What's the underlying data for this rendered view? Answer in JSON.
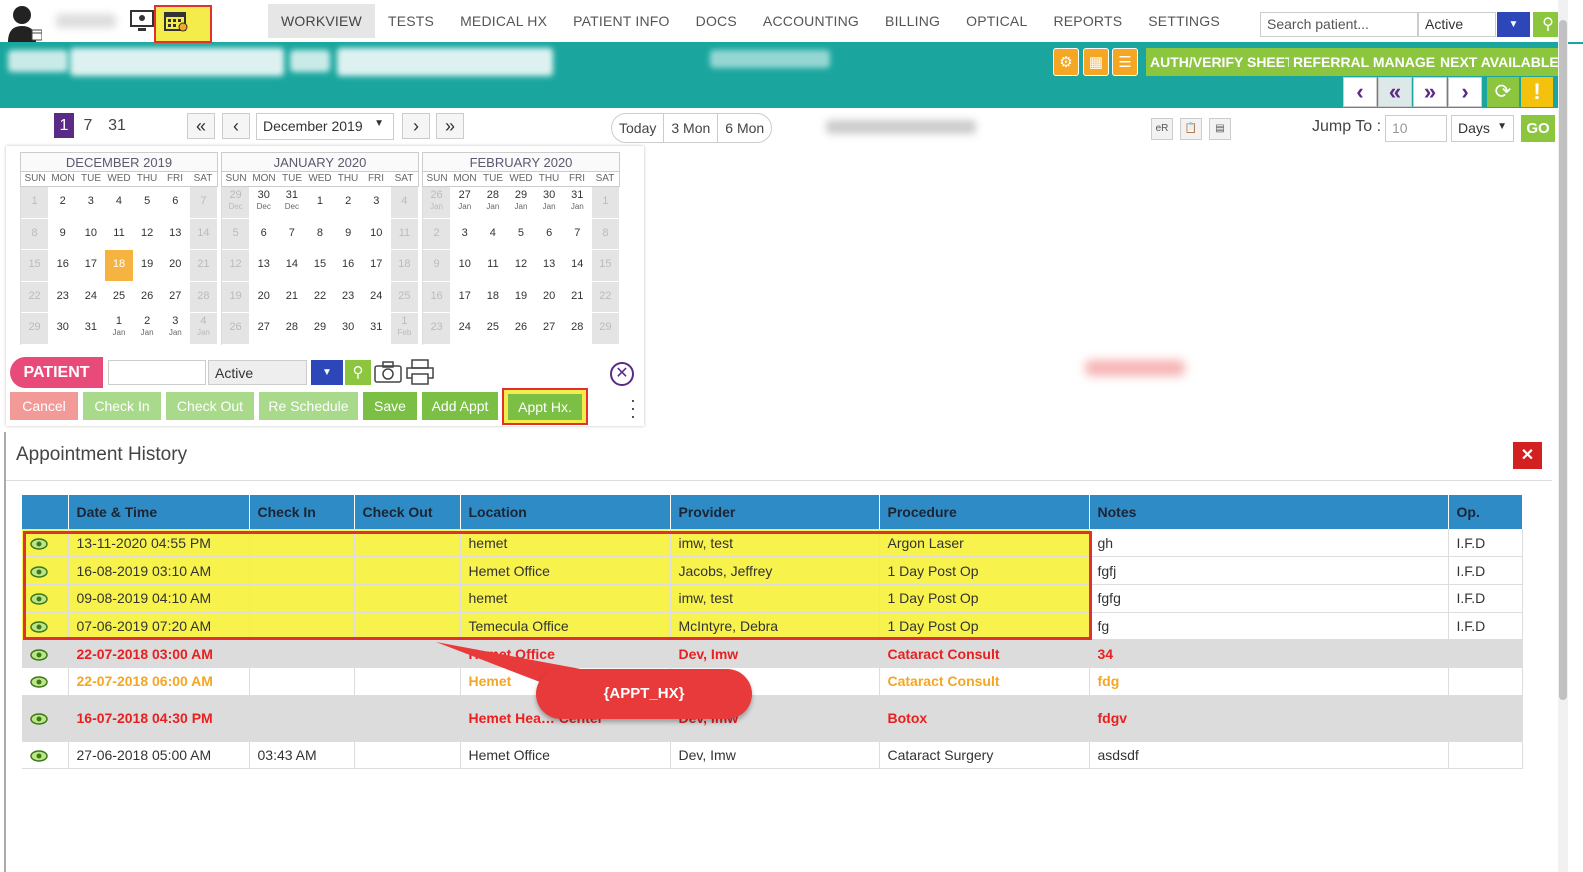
{
  "nav": {
    "items": [
      "WORKVIEW",
      "TESTS",
      "MEDICAL HX",
      "PATIENT INFO",
      "DOCS",
      "ACCOUNTING",
      "BILLING",
      "OPTICAL",
      "REPORTS",
      "SETTINGS"
    ],
    "active": "WORKVIEW"
  },
  "search": {
    "placeholder": "Search patient...",
    "status": "Active"
  },
  "teal_toolbar": {
    "buttons": [
      "AUTH/VERIFY SHEET",
      "REFERRAL MANAGER",
      "NEXT AVAILABLE"
    ]
  },
  "view": {
    "counts": [
      "1",
      "7",
      "31"
    ],
    "month": "December 2019",
    "ranges": [
      "Today",
      "3 Mon",
      "6 Mon"
    ],
    "jump_label": "Jump To :",
    "jump_placeholder": "10",
    "jump_unit": "Days",
    "go_label": "GO",
    "small_icon_er": "eR"
  },
  "dow": [
    "SUN",
    "MON",
    "TUE",
    "WED",
    "THU",
    "FRI",
    "SAT"
  ],
  "calendars": [
    {
      "title": "DECEMBER 2019"
    },
    {
      "title": "JANUARY 2020"
    },
    {
      "title": "FEBRUARY 2020"
    }
  ],
  "patient_bar": {
    "label": "PATIENT",
    "status": "Active"
  },
  "actions": {
    "cancel": "Cancel",
    "check_in": "Check In",
    "check_out": "Check Out",
    "reschedule": "Re Schedule",
    "save": "Save",
    "add_appt": "Add Appt",
    "appt_hx": "Appt Hx."
  },
  "history": {
    "title": "Appointment History",
    "columns": [
      "Date & Time",
      "Check In",
      "Check Out",
      "Location",
      "Provider",
      "Procedure",
      "Notes",
      "Op."
    ],
    "rows": [
      {
        "date": "13-11-2020 04:55 PM",
        "check_in": "",
        "check_out": "",
        "location": "hemet",
        "provider": "imw, test",
        "procedure": "Argon Laser",
        "notes": "gh",
        "op": "I.F.D"
      },
      {
        "date": "16-08-2019 03:10 AM",
        "check_in": "",
        "check_out": "",
        "location": "Hemet Office",
        "provider": "Jacobs, Jeffrey",
        "procedure": "1 Day Post Op",
        "notes": "fgfj",
        "op": "I.F.D"
      },
      {
        "date": "09-08-2019 04:10 AM",
        "check_in": "",
        "check_out": "",
        "location": "hemet",
        "provider": "imw, test",
        "procedure": "1 Day Post Op",
        "notes": "fgfg",
        "op": "I.F.D"
      },
      {
        "date": "07-06-2019 07:20 AM",
        "check_in": "",
        "check_out": "",
        "location": "Temecula Office",
        "provider": "McIntyre, Debra",
        "procedure": "1 Day Post Op",
        "notes": "fg",
        "op": "I.F.D"
      },
      {
        "date": "22-07-2018 03:00 AM",
        "check_in": "",
        "check_out": "",
        "location": "Hemet Office",
        "provider": "Dev, Imw",
        "procedure": "Cataract Consult",
        "notes": "34",
        "op": ""
      },
      {
        "date": "22-07-2018 06:00 AM",
        "check_in": "",
        "check_out": "",
        "location": "Hemet",
        "provider": "",
        "procedure": "Cataract Consult",
        "notes": "fdg",
        "op": ""
      },
      {
        "date": "16-07-2018 04:30 PM",
        "check_in": "",
        "check_out": "",
        "location": "Hemet Hea… Center",
        "provider": "Dev, Imw",
        "procedure": "Botox",
        "notes": "fdgv",
        "op": ""
      },
      {
        "date": "27-06-2018 05:00 AM",
        "check_in": "03:43 AM",
        "check_out": "",
        "location": "Hemet Office",
        "provider": "Dev, Imw",
        "procedure": "Cataract Surgery",
        "notes": "asdsdf",
        "op": ""
      }
    ]
  },
  "callout": "{APPT_HX}",
  "colors": {
    "teal": "#1aa69e",
    "purple": "#5b2a86",
    "green": "#8cc63f",
    "pink": "#e84a79",
    "header_blue": "#2f8bc6",
    "highlight_yellow": "#f7f24c",
    "alert_red": "#e83a3a"
  }
}
